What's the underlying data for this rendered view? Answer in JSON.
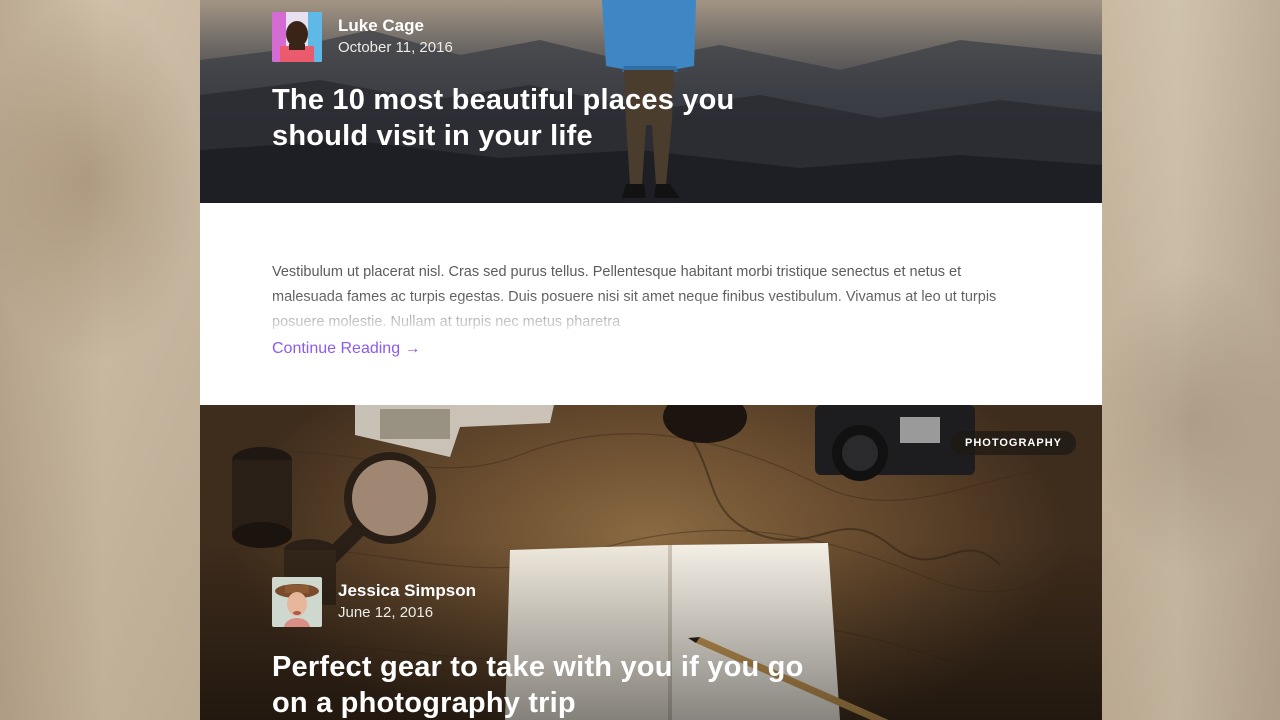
{
  "posts": [
    {
      "author_name": "Luke Cage",
      "date": "October 11, 2016",
      "title_line1": "The 10 most beautiful places you",
      "title_line2": "should visit in your life",
      "excerpt": "Vestibulum ut placerat nisl. Cras sed purus tellus. Pellentesque habitant morbi tristique senectus et netus et malesuada fames ac turpis egestas. Duis posuere nisi sit amet neque finibus vestibulum. Vivamus at leo ut turpis posuere molestie. Nullam at turpis nec metus pharetra",
      "continue_label": "Continue Reading →"
    },
    {
      "author_name": "Jessica Simpson",
      "date": "June 12, 2016",
      "category": "PHOTOGRAPHY",
      "title_line1": "Perfect gear to take with you if you go",
      "title_line2": "on a photography trip"
    }
  ],
  "colors": {
    "link": "#8a5cf0",
    "card_body": "#ffffff"
  },
  "icons": [
    "author-avatar",
    "hero-image"
  ]
}
